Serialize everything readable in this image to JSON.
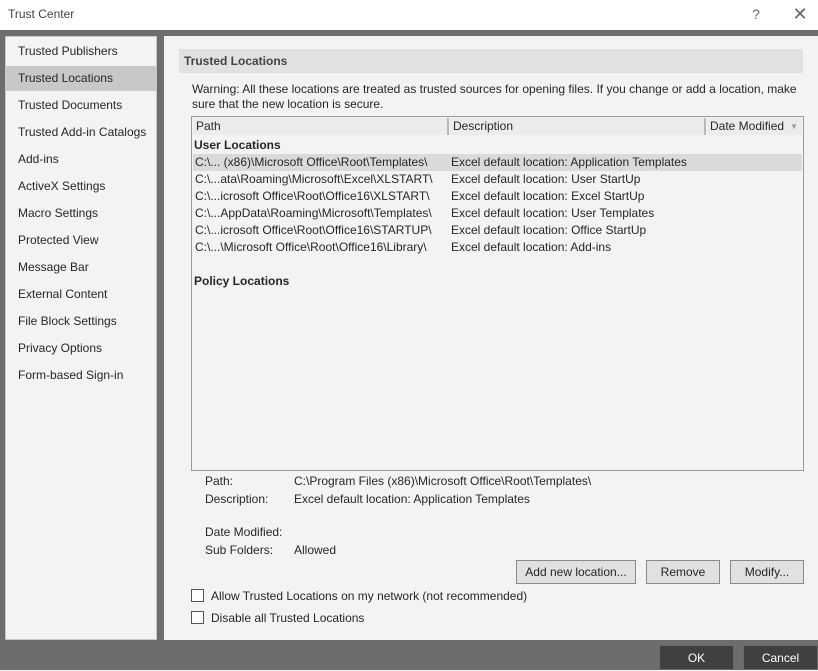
{
  "window": {
    "title": "Trust Center",
    "help_glyph": "?",
    "close_glyph": "✕"
  },
  "sidebar": {
    "items": [
      {
        "label": "Trusted Publishers"
      },
      {
        "label": "Trusted Locations",
        "selected": true
      },
      {
        "label": "Trusted Documents"
      },
      {
        "label": "Trusted Add-in Catalogs"
      },
      {
        "label": "Add-ins"
      },
      {
        "label": "ActiveX Settings"
      },
      {
        "label": "Macro Settings"
      },
      {
        "label": "Protected View"
      },
      {
        "label": "Message Bar"
      },
      {
        "label": "External Content"
      },
      {
        "label": "File Block Settings"
      },
      {
        "label": "Privacy Options"
      },
      {
        "label": "Form-based Sign-in"
      }
    ]
  },
  "main": {
    "header": "Trusted Locations",
    "warning": "Warning: All these locations are treated as trusted sources for opening files.  If you change or add a location, make sure that the new location is secure.",
    "columns": {
      "path": "Path",
      "description": "Description",
      "date_modified": "Date Modified"
    },
    "user_locations_label": "User Locations",
    "rows": [
      {
        "path": "C:\\... (x86)\\Microsoft Office\\Root\\Templates\\",
        "description": "Excel default location: Application Templates",
        "selected": true
      },
      {
        "path": "C:\\...ata\\Roaming\\Microsoft\\Excel\\XLSTART\\",
        "description": "Excel default location: User StartUp"
      },
      {
        "path": "C:\\...icrosoft Office\\Root\\Office16\\XLSTART\\",
        "description": "Excel default location: Excel StartUp"
      },
      {
        "path": "C:\\...AppData\\Roaming\\Microsoft\\Templates\\",
        "description": "Excel default location: User Templates"
      },
      {
        "path": "C:\\...icrosoft Office\\Root\\Office16\\STARTUP\\",
        "description": "Excel default location: Office StartUp"
      },
      {
        "path": "C:\\...\\Microsoft Office\\Root\\Office16\\Library\\",
        "description": "Excel default location: Add-ins"
      }
    ],
    "policy_locations_label": "Policy Locations",
    "details": {
      "path_label": "Path:",
      "path_value": "C:\\Program Files (x86)\\Microsoft Office\\Root\\Templates\\",
      "description_label": "Description:",
      "description_value": "Excel default location: Application Templates",
      "date_modified_label": "Date Modified:",
      "date_modified_value": "",
      "sub_folders_label": "Sub Folders:",
      "sub_folders_value": "Allowed"
    },
    "buttons": {
      "add": "Add new location...",
      "remove": "Remove",
      "modify": "Modify..."
    },
    "checkboxes": {
      "allow_network": {
        "label": "Allow Trusted Locations on my network (not recommended)",
        "checked": false
      },
      "disable_all": {
        "label": "Disable all Trusted Locations",
        "checked": false
      }
    }
  },
  "footer": {
    "ok": "OK",
    "cancel": "Cancel"
  }
}
